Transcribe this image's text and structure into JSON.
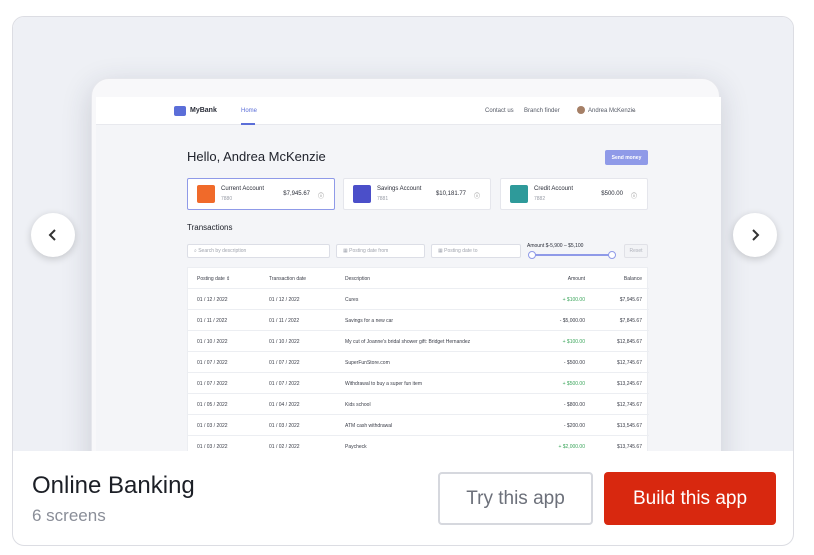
{
  "app": {
    "name": "MyBank",
    "nav": {
      "home": "Home",
      "contact": "Contact us",
      "branch": "Branch finder",
      "user": "Andrea McKenzie",
      "chevron": "⌄"
    },
    "greeting": "Hello, Andrea McKenzie",
    "send_money": "Send money",
    "accounts": [
      {
        "name": "Current Account",
        "number": "7880",
        "balance": "$7,945.67",
        "color": "#f06a2a"
      },
      {
        "name": "Savings Account",
        "number": "7881",
        "balance": "$10,181.77",
        "color": "#4b4fc9"
      },
      {
        "name": "Credit Account",
        "number": "7882",
        "balance": "$500.00",
        "color": "#2e9a9a"
      }
    ],
    "transactions_title": "Transactions",
    "filters": {
      "search_placeholder": "Search by description",
      "from_placeholder": "Posting date from",
      "to_placeholder": "Posting date to",
      "amount_label": "Amount  $-5,900 – $5,100",
      "reset": "Reset"
    },
    "table": {
      "headers": [
        "Posting date ⇕",
        "Transaction date",
        "Description",
        "Amount",
        "Balance"
      ],
      "rows": [
        [
          "01 / 12 / 2022",
          "01 / 12 / 2022",
          "Cures",
          "+ $100.00",
          "$7,945.67"
        ],
        [
          "01 / 11 / 2022",
          "01 / 11 / 2022",
          "Savings for a new car",
          "- $5,000.00",
          "$7,845.67"
        ],
        [
          "01 / 10 / 2022",
          "01 / 10 / 2022",
          "My cut of Joanne's bridal shower gift: Bridget Hernandez",
          "+ $100.00",
          "$12,845.67"
        ],
        [
          "01 / 07 / 2022",
          "01 / 07 / 2022",
          "SuperFunStore.com",
          "- $500.00",
          "$12,745.67"
        ],
        [
          "01 / 07 / 2022",
          "01 / 07 / 2022",
          "Withdrawal to buy a super fun item",
          "+ $500.00",
          "$13,245.67"
        ],
        [
          "01 / 05 / 2022",
          "01 / 04 / 2022",
          "Kids school",
          "- $800.00",
          "$12,745.67"
        ],
        [
          "01 / 03 / 2022",
          "01 / 03 / 2022",
          "ATM cash withdrawal",
          "- $200.00",
          "$13,545.67"
        ],
        [
          "01 / 03 / 2022",
          "01 / 02 / 2022",
          "Paycheck",
          "+ $2,000.00",
          "$13,745.67"
        ]
      ]
    }
  },
  "card": {
    "title": "Online Banking",
    "subtitle": "6 screens",
    "try_label": "Try this app",
    "build_label": "Build this app"
  },
  "icons": {
    "left": "chevron-left-icon",
    "right": "chevron-right-icon",
    "calendar": "calendar-icon",
    "search": "search-icon"
  }
}
